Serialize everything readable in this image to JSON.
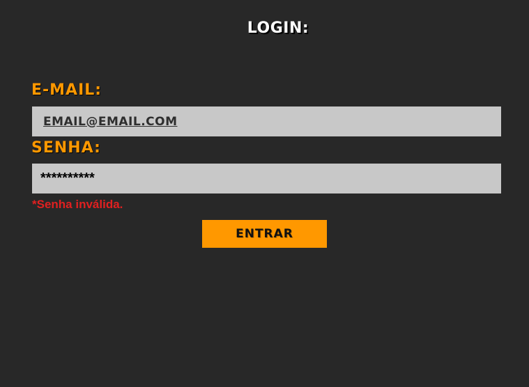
{
  "page": {
    "title": "LOGIN:"
  },
  "form": {
    "email_label": "E-MAIL:",
    "email_placeholder": "EMAIL@EMAIL.COM",
    "senha_label": "SENHA:",
    "senha_value": "**********",
    "error_message": "*Senha inválida.",
    "submit_label": "ENTRAR"
  },
  "colors": {
    "background": "#282828",
    "accent": "#ff9800",
    "input_bg": "#c8c8c8",
    "error": "#e02020",
    "title": "#ffffff"
  }
}
